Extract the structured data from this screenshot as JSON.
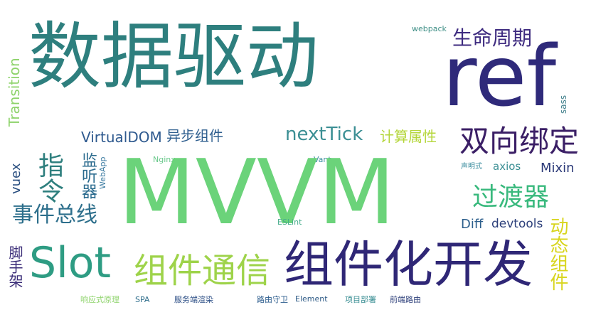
{
  "words": [
    {
      "text": "数据驱动",
      "color": "#2e7f7e"
    },
    {
      "text": "ref",
      "color": "#2f2a7a"
    },
    {
      "text": "生命周期",
      "color": "#3d2a7f"
    },
    {
      "text": "webpack",
      "color": "#3f8f86"
    },
    {
      "text": "sass",
      "color": "#3e7e8a"
    },
    {
      "text": "Transition",
      "color": "#8ed36b"
    },
    {
      "text": "VirtualDOM",
      "color": "#2f5a8f"
    },
    {
      "text": "异步组件",
      "color": "#2f5f8f"
    },
    {
      "text": "nextTick",
      "color": "#3b8f94"
    },
    {
      "text": "计算属性",
      "color": "#b4d63a"
    },
    {
      "text": "双向绑定",
      "color": "#3b1f66"
    },
    {
      "text": "指令",
      "color": "#2e7f7e"
    },
    {
      "text": "监听器",
      "color": "#2b6b8e"
    },
    {
      "text": "WebApp",
      "color": "#3a7aa0"
    },
    {
      "text": "vuex",
      "color": "#2a4f80"
    },
    {
      "text": "Nginx",
      "color": "#68c88a"
    },
    {
      "text": "Vant",
      "color": "#3f8fa0"
    },
    {
      "text": "MVVM",
      "color": "#6bd37a"
    },
    {
      "text": "声明式",
      "color": "#3f8fa0"
    },
    {
      "text": "axios",
      "color": "#3b8f94"
    },
    {
      "text": "Mixin",
      "color": "#2c3a78"
    },
    {
      "text": "过渡器",
      "color": "#39b97d"
    },
    {
      "text": "事件总线",
      "color": "#2d6f8c"
    },
    {
      "text": "Diff",
      "color": "#2d5f8c"
    },
    {
      "text": "devtools",
      "color": "#2c3f7a"
    },
    {
      "text": "ESLint",
      "color": "#47ad8c"
    },
    {
      "text": "动态组件",
      "color": "#d8d51e"
    },
    {
      "text": "脚手架",
      "color": "#3b2d78"
    },
    {
      "text": "Slot",
      "color": "#2e9c83"
    },
    {
      "text": "组件通信",
      "color": "#9ed34a"
    },
    {
      "text": "组件化开发",
      "color": "#2f2776"
    },
    {
      "text": "响应式原理",
      "color": "#8ed36b"
    },
    {
      "text": "SPA",
      "color": "#2f6e8c"
    },
    {
      "text": "服务端渲染",
      "color": "#2d4f86"
    },
    {
      "text": "路由守卫",
      "color": "#2f5f8f"
    },
    {
      "text": "Element",
      "color": "#2d5a86"
    },
    {
      "text": "项目部署",
      "color": "#3b8f94"
    },
    {
      "text": "前端路由",
      "color": "#2d3f7a"
    }
  ]
}
